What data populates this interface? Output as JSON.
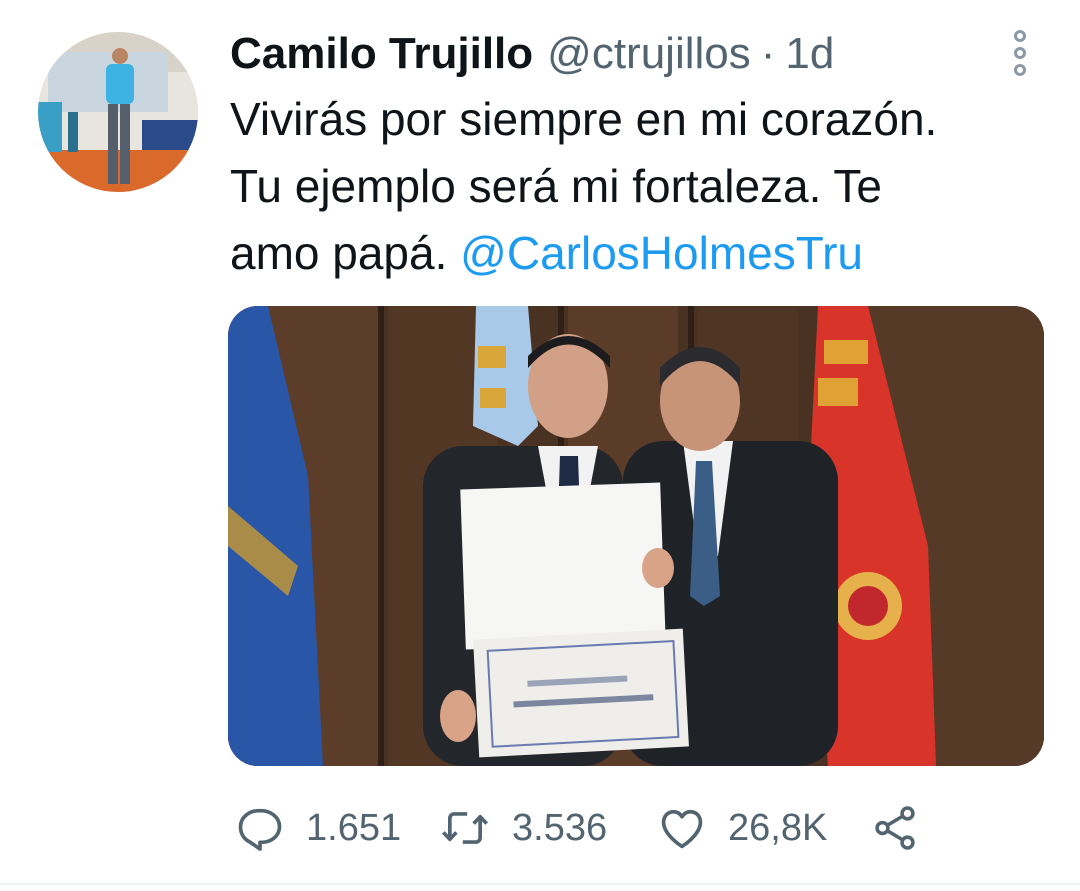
{
  "tweet": {
    "author_name": "Camilo Trujillo",
    "handle": "@ctrujillos",
    "separator": "·",
    "time": "1d",
    "text_lines": [
      "Vivirás por siempre en mi corazón.",
      "Tu ejemplo será mi fortaleza. Te",
      "amo papá. "
    ],
    "mention": "@CarlosHolmesTru",
    "avatar_icon": "profile-photo",
    "more_icon": "more-vertical-icon"
  },
  "actions": {
    "replies": "1.651",
    "retweets": "3.536",
    "likes": "26,8K",
    "reply_icon": "reply-icon",
    "retweet_icon": "retweet-icon",
    "like_icon": "heart-icon",
    "share_icon": "share-icon"
  },
  "colors": {
    "text": "#0f1419",
    "secondary": "#536471",
    "link": "#1d9bf0"
  }
}
